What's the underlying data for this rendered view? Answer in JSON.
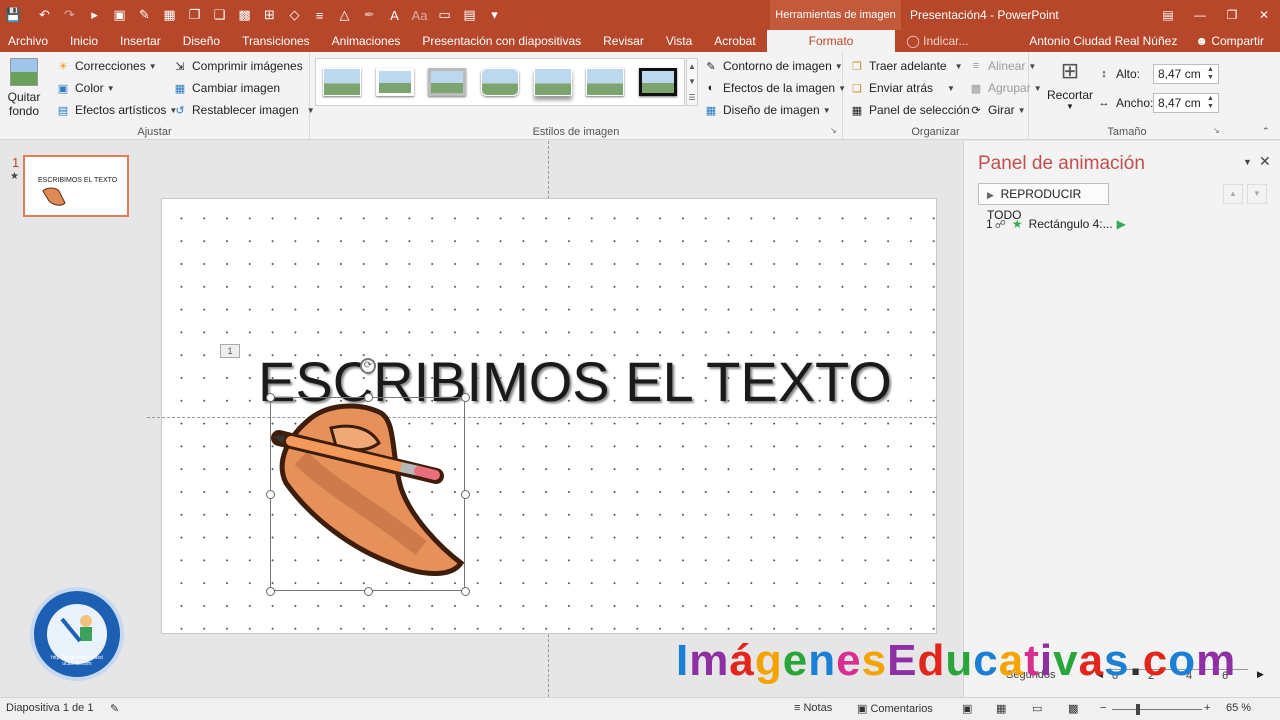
{
  "app": {
    "context_tab_group": "Herramientas de imagen",
    "window_title": "Presentación4 - PowerPoint"
  },
  "tabs": [
    "Archivo",
    "Inicio",
    "Insertar",
    "Diseño",
    "Transiciones",
    "Animaciones",
    "Presentación con diapositivas",
    "Revisar",
    "Vista",
    "Acrobat"
  ],
  "active_tab": "Formato",
  "tell_me": "Indicar...",
  "user": "Antonio Ciudad Real Núñez",
  "share": "Compartir",
  "ribbon": {
    "quitar_fondo_1": "Quitar",
    "quitar_fondo_2": "fondo",
    "correcciones": "Correcciones",
    "color": "Color",
    "efectos_artisticos": "Efectos artísticos",
    "comprimir": "Comprimir imágenes",
    "cambiar": "Cambiar imagen",
    "restablecer": "Restablecer imagen",
    "group_ajustar": "Ajustar",
    "group_estilos": "Estilos de imagen",
    "contorno": "Contorno de imagen",
    "efectos_imagen": "Efectos de la imagen",
    "diseno_imagen": "Diseño de imagen",
    "traer_adelante": "Traer adelante",
    "enviar_atras": "Enviar atrás",
    "panel_seleccion": "Panel de selección",
    "alinear": "Alinear",
    "agrupar": "Agrupar",
    "girar": "Girar",
    "group_organizar": "Organizar",
    "recortar": "Recortar",
    "alto_label": "Alto:",
    "alto_value": "8,47 cm",
    "ancho_label": "Ancho:",
    "ancho_value": "8,47 cm",
    "group_tamano": "Tamaño"
  },
  "thumbnail": {
    "number": "1",
    "star": "★",
    "title": "ESCRIBIMOS EL TEXTO"
  },
  "slide": {
    "title": "ESCRIBIMOS EL TEXTO",
    "anim_tag": "1"
  },
  "animation_pane": {
    "title": "Panel de animación",
    "play_all": "REPRODUCIR TODO",
    "item_number": "1",
    "item_label": "Rectángulo 4:...",
    "timeline_label": "Segundos",
    "timeline_ticks": [
      "0",
      "2",
      "4",
      "6"
    ]
  },
  "status": {
    "slide_info": "Diapositiva 1 de 1",
    "notes": "Notas",
    "comments": "Comentarios",
    "zoom": "65 %"
  },
  "watermark": {
    "letters": [
      "I",
      "m",
      "á",
      "g",
      "e",
      "n",
      "e",
      "s",
      "E",
      "d",
      "u",
      "c",
      "a",
      "t",
      "i",
      "v",
      "a",
      "s",
      ".",
      "c",
      "o",
      "m"
    ],
    "colors": [
      "#1b7fd6",
      "#8e2fa3",
      "#e3261c",
      "#f4a300",
      "#2aa53a",
      "#1b7fd6",
      "#d72f8f",
      "#f4a300",
      "#8e2fa3",
      "#e3261c",
      "#2aa53a",
      "#1b7fd6",
      "#f4a300",
      "#d72f8f",
      "#8e2fa3",
      "#2aa53a",
      "#e3261c",
      "#1b7fd6",
      "#333333",
      "#e3261c",
      "#1b7fd6",
      "#8e2fa3"
    ]
  },
  "logo": {
    "text": "http://www.imagenesed ucativas.com"
  },
  "colors": {
    "accent": "#b7472a",
    "ribbon_bg": "#f3f3f3",
    "pane_title": "#c0504d"
  }
}
